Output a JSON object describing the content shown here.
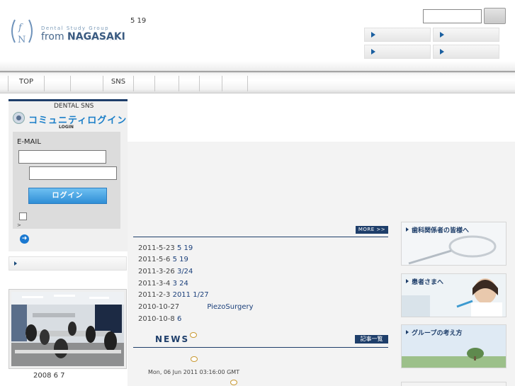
{
  "header": {
    "logo_sub": "Dental Study Group",
    "logo_from": "from ",
    "logo_name": "NAGASAKI",
    "date_text": "5 19"
  },
  "nav": {
    "items": [
      "TOP",
      "",
      "",
      "SNS",
      "",
      "",
      "",
      "",
      ""
    ]
  },
  "sns": {
    "label": "DENTAL SNS",
    "title": "コミュニティログイン",
    "subtitle": "LOGIN",
    "email_label": "E-MAIL",
    "login_button": "ログイン",
    "gt": ">"
  },
  "photo": {
    "caption": "2008 6 7"
  },
  "more": {
    "label": "MORE >>"
  },
  "news_list": [
    {
      "date": "2011-5-23",
      "title": "5 19"
    },
    {
      "date": "2011-5-6",
      "title": "5 19"
    },
    {
      "date": "2011-3-26",
      "title": "3/24"
    },
    {
      "date": "2011-3-4",
      "title": "3 24"
    },
    {
      "date": "2011-2-3",
      "title": "2011  1/27"
    },
    {
      "date": "2010-10-27",
      "title": "PiezoSurgery"
    },
    {
      "date": "2010-10-8",
      "title": "6"
    }
  ],
  "news": {
    "heading": "NEWS",
    "list_button": "記事一覧",
    "date": "Mon, 06 Jun 2011 03:16:00 GMT"
  },
  "banners": {
    "dental": "歯科関係者の皆様へ",
    "patients": "患者さまへ",
    "group": "グループの考え方"
  }
}
